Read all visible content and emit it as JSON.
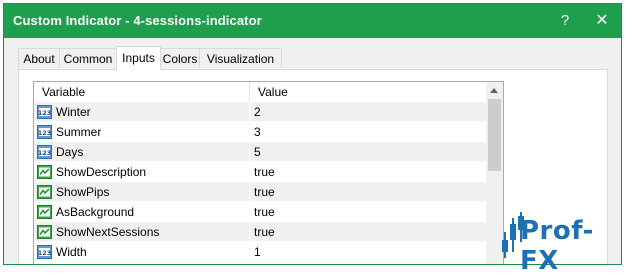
{
  "window": {
    "title": "Custom Indicator - 4-sessions-indicator",
    "help_label": "?",
    "close_label": "✕"
  },
  "tabs": [
    {
      "label": "About"
    },
    {
      "label": "Common"
    },
    {
      "label": "Inputs"
    },
    {
      "label": "Colors"
    },
    {
      "label": "Visualization"
    }
  ],
  "active_tab": "Inputs",
  "grid": {
    "columns": [
      "Variable",
      "Value"
    ],
    "rows": [
      {
        "name": "Winter",
        "value": "2",
        "type": "int",
        "icon": "int-param-icon"
      },
      {
        "name": "Summer",
        "value": "3",
        "type": "int",
        "icon": "int-param-icon"
      },
      {
        "name": "Days",
        "value": "5",
        "type": "int",
        "icon": "int-param-icon"
      },
      {
        "name": "ShowDescription",
        "value": "true",
        "type": "bool",
        "icon": "bool-param-icon"
      },
      {
        "name": "ShowPips",
        "value": "true",
        "type": "bool",
        "icon": "bool-param-icon"
      },
      {
        "name": "AsBackground",
        "value": "true",
        "type": "bool",
        "icon": "bool-param-icon"
      },
      {
        "name": "ShowNextSessions",
        "value": "true",
        "type": "bool",
        "icon": "bool-param-icon"
      },
      {
        "name": "Width",
        "value": "1",
        "type": "int",
        "icon": "int-param-icon"
      }
    ]
  },
  "watermark": {
    "text": "Prof-FX"
  },
  "colors": {
    "titlebar": "#1e9f4e",
    "watermark": "#1f6fb4"
  }
}
